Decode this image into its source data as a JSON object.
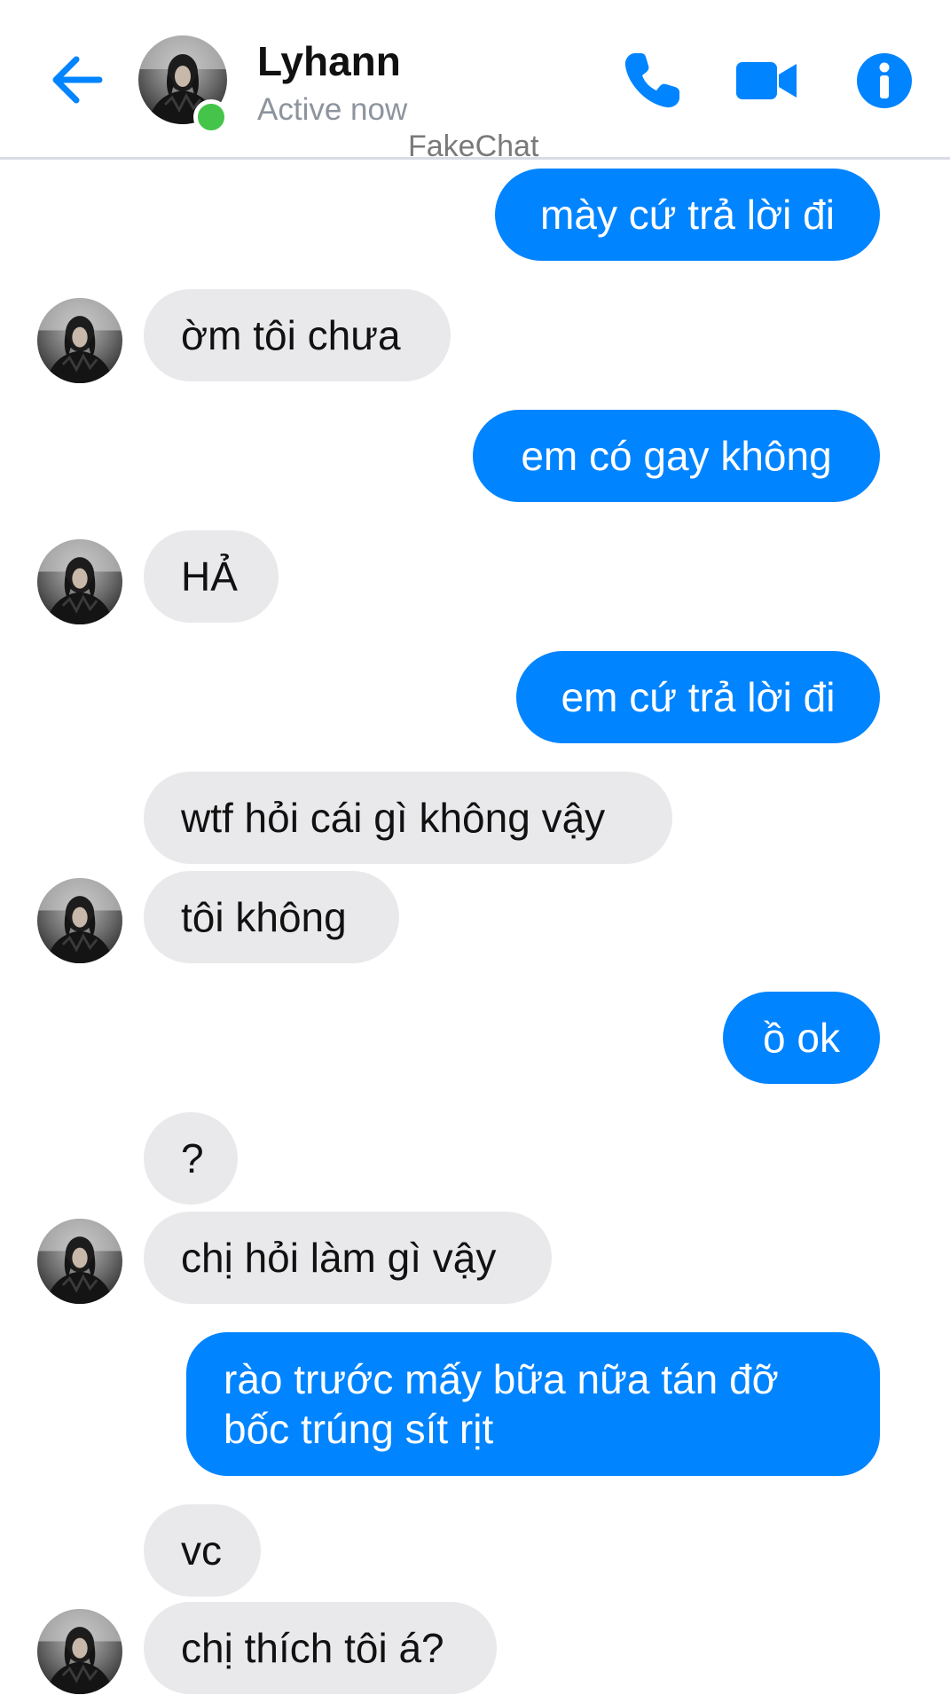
{
  "header": {
    "contact_name": "Lyhann",
    "status": "Active now",
    "watermark": "FakeChat",
    "icons": [
      "back-arrow-icon",
      "phone-icon",
      "video-camera-icon",
      "info-icon"
    ],
    "accent_color": "#0084ff",
    "online_color": "#44c54a"
  },
  "messages": [
    {
      "side": "out",
      "text": "mày cứ trả lời đi"
    },
    {
      "side": "in",
      "text": "ờm tôi chưa"
    },
    {
      "side": "out",
      "text": "em có gay không"
    },
    {
      "side": "in",
      "text": "HẢ"
    },
    {
      "side": "out",
      "text": "em cứ trả lời đi"
    },
    {
      "side": "in",
      "text": "wtf hỏi cái gì không vậy"
    },
    {
      "side": "in",
      "text": "tôi không"
    },
    {
      "side": "out",
      "text": "ồ ok"
    },
    {
      "side": "in",
      "text": "?"
    },
    {
      "side": "in",
      "text": "chị hỏi làm gì vậy"
    },
    {
      "side": "out",
      "lines": [
        "rào trước mấy bữa nữa tán đỡ",
        "bốc trúng sít rịt"
      ]
    },
    {
      "side": "in",
      "text": "vc"
    },
    {
      "side": "in",
      "text": "chị thích tôi á?"
    }
  ],
  "colors": {
    "outgoing_bubble": "#0084ff",
    "incoming_bubble": "#e9e9eb"
  }
}
